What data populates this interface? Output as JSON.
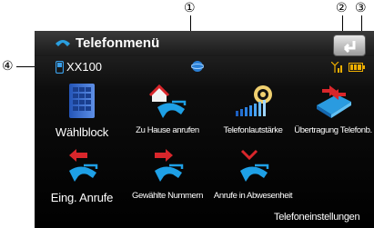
{
  "callouts": {
    "c1": "①",
    "c2": "②",
    "c3": "③",
    "c4": "④"
  },
  "header": {
    "title": "Telefonmenü"
  },
  "status": {
    "device": "XX100"
  },
  "menu": {
    "row1": [
      "Wählblock",
      "Zu Hause anrufen",
      "Telefonlautstärke",
      "Übertragung Telefonb."
    ],
    "row2": [
      "Eing. Anrufe",
      "Gewählte Nummern",
      "Anrufe in Abwesenheit"
    ]
  },
  "footer": {
    "settings": "Telefoneinstellungen"
  },
  "colors": {
    "accent_blue": "#2a7fd4",
    "call_red": "#d9262b",
    "battery": "#f0b000"
  },
  "icons": [
    "phone-icon",
    "back-icon",
    "bluetooth-phone-icon",
    "globe-icon",
    "signal-icon",
    "battery-icon",
    "keypad-icon",
    "home-call-icon",
    "volume-icon",
    "phonebook-transfer-icon",
    "incoming-call-icon",
    "outgoing-call-icon",
    "missed-call-icon"
  ]
}
